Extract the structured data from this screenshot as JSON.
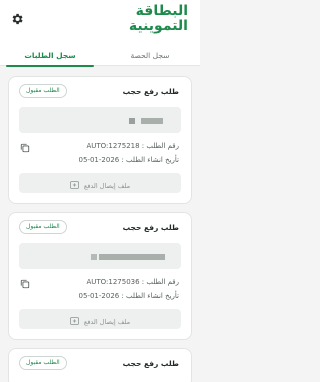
{
  "app": {
    "logo_line1": "البطاقة",
    "logo_line2": "التموينية"
  },
  "tabs": [
    {
      "label": "سجل الحصة",
      "active": false
    },
    {
      "label": "سجل الطلبات",
      "active": true
    }
  ],
  "cards": [
    {
      "title": "طلب رفع حجب",
      "status": "الطلب مقبول",
      "request_number": "رقم الطلب : AUTO:1275218",
      "created_date": "تأريخ انشاء الطلب : 2026-01-05",
      "receipt_label": "ملف إيصال الدفع"
    },
    {
      "title": "طلب رفع حجب",
      "status": "الطلب مقبول",
      "request_number": "رقم الطلب : AUTO:1275036",
      "created_date": "تأريخ انشاء الطلب : 2026-01-05",
      "receipt_label": "ملف إيصال الدفع"
    },
    {
      "title": "طلب رفع حجب",
      "status": "الطلب مقبول"
    }
  ],
  "colors": {
    "accent": "#1e8a4c",
    "background": "#f3f4f3",
    "card": "#ffffff",
    "muted_field": "#eef0ef"
  },
  "icons": {
    "settings": "gear-icon",
    "copy": "copy-icon",
    "receipt": "add-photo-icon"
  }
}
